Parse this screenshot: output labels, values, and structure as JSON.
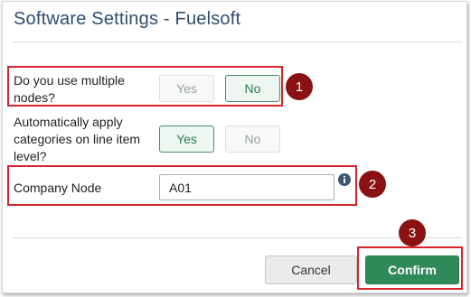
{
  "dialog": {
    "title": "Software Settings - Fuelsoft"
  },
  "settings": {
    "multiple_nodes": {
      "label": "Do you use multiple nodes?",
      "yes_label": "Yes",
      "no_label": "No",
      "selected": "No"
    },
    "auto_categories": {
      "label": "Automatically apply categories on line item level?",
      "yes_label": "Yes",
      "no_label": "No",
      "selected": "Yes"
    },
    "company_node": {
      "label": "Company Node",
      "value": "A01",
      "info_icon": "info-circle-icon"
    }
  },
  "footer": {
    "cancel_label": "Cancel",
    "confirm_label": "Confirm"
  },
  "annotations": {
    "badge_1": "1",
    "badge_2": "2",
    "badge_3": "3"
  },
  "colors": {
    "title": "#2f4d6e",
    "accent_green": "#2e8a58",
    "highlight_red": "#d8232a",
    "badge": "#8b1212"
  }
}
